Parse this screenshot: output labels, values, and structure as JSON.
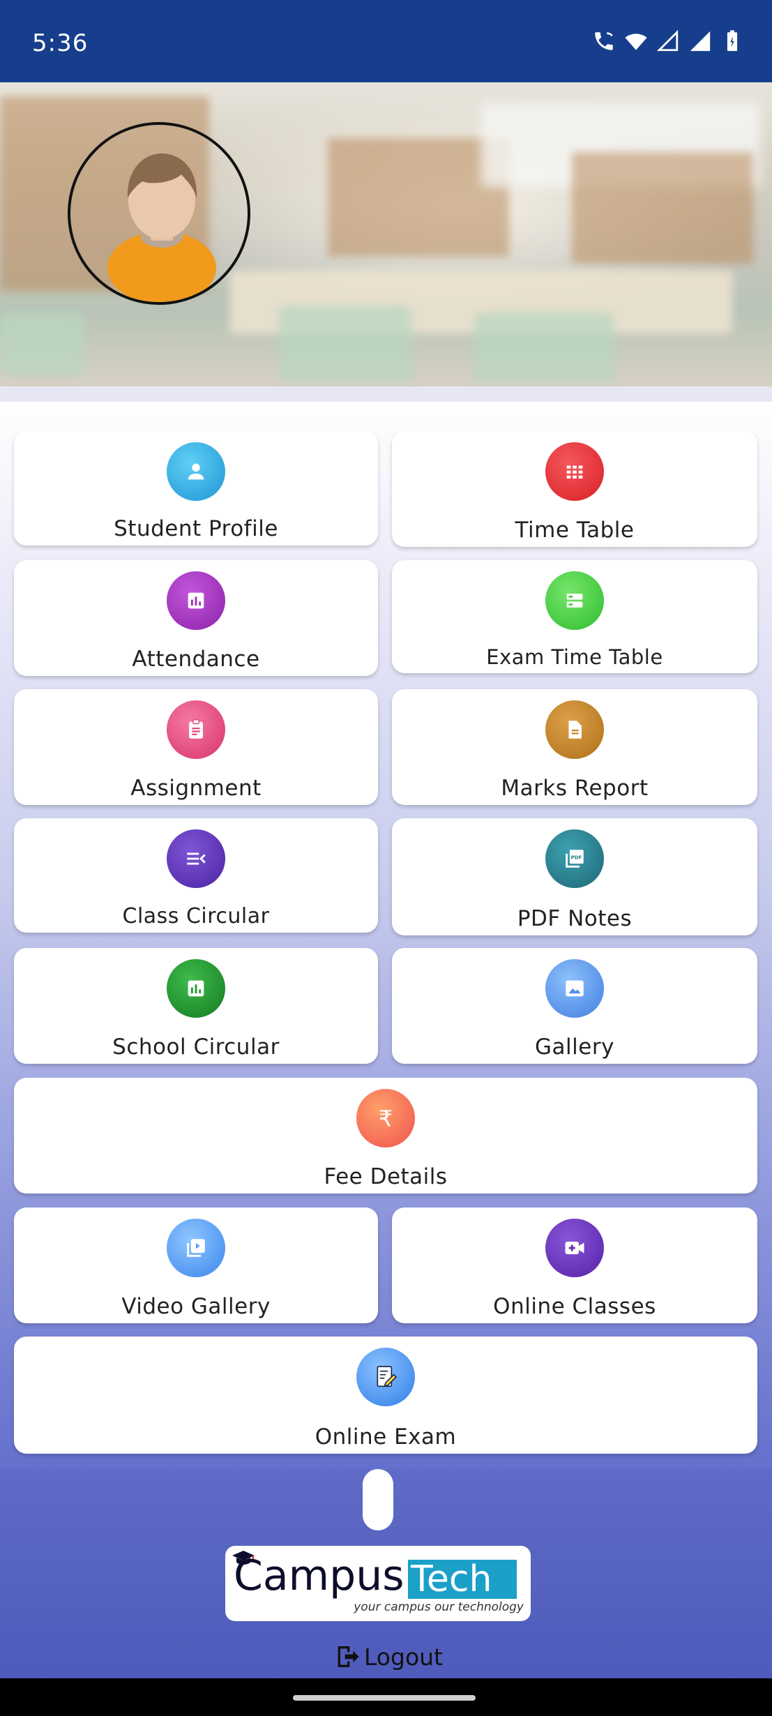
{
  "status_bar": {
    "time": "5:36"
  },
  "menu": {
    "student_profile": "Student Profile",
    "time_table": "Time Table",
    "attendance": "Attendance",
    "exam_time_table": "Exam Time Table",
    "assignment": "Assignment",
    "marks_report": "Marks Report",
    "class_circular": "Class Circular",
    "pdf_notes": "PDF Notes",
    "school_circular": "School Circular",
    "gallery": "Gallery",
    "fee_details": "Fee Details",
    "video_gallery": "Video Gallery",
    "online_classes": "Online Classes",
    "online_exam": "Online Exam"
  },
  "icons": {
    "student_profile": "person-icon",
    "time_table": "grid-icon",
    "attendance": "bar-chart-icon",
    "exam_time_table": "storage-icon",
    "assignment": "clipboard-icon",
    "marks_report": "document-icon",
    "class_circular": "list-icon",
    "pdf_notes": "pdf-icon",
    "school_circular": "bar-chart-icon",
    "gallery": "image-icon",
    "fee_details": "rupee-icon",
    "video_gallery": "video-library-icon",
    "online_classes": "video-call-icon",
    "online_exam": "exam-edit-icon"
  },
  "colors": {
    "status_bar": "#163e8c",
    "student_profile": "#29a9e0",
    "time_table": "#e5272c",
    "attendance": "#9c2fb7",
    "exam_time_table": "#3fce3d",
    "assignment": "#e6457b",
    "marks_report": "#c38527",
    "class_circular": "#5b33b9",
    "pdf_notes": "#2a7c8c",
    "school_circular": "#1f9b2c",
    "gallery": "#4d8fea",
    "fee_details": "#f86b59",
    "video_gallery": "#5b9ff0",
    "online_classes": "#6a30b8",
    "online_exam": "#3c8ff0"
  },
  "logo": {
    "campus": "Campus",
    "tech": "Tech",
    "tagline": "your campus our technology"
  },
  "logout_label": "Logout"
}
